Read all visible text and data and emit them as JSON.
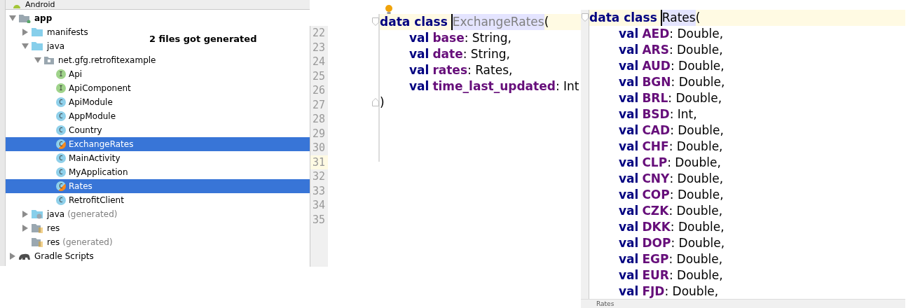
{
  "project_panel": {
    "view_selector": "Android",
    "tree": [
      {
        "label": "app",
        "kind": "module",
        "expanded": true,
        "children": [
          {
            "label": "manifests",
            "kind": "folder",
            "expanded": false
          },
          {
            "label": "java",
            "kind": "folder",
            "expanded": true,
            "children": [
              {
                "label": "net.gfg.retrofitexample",
                "kind": "package",
                "expanded": true,
                "children": [
                  {
                    "label": "Api",
                    "kind": "interface",
                    "badge": "I",
                    "selected": false
                  },
                  {
                    "label": "ApiComponent",
                    "kind": "interface",
                    "badge": "I",
                    "selected": false
                  },
                  {
                    "label": "ApiModule",
                    "kind": "class",
                    "badge": "C",
                    "selected": false
                  },
                  {
                    "label": "AppModule",
                    "kind": "class",
                    "badge": "C",
                    "selected": false
                  },
                  {
                    "label": "Country",
                    "kind": "class",
                    "badge": "C",
                    "selected": false
                  },
                  {
                    "label": "ExchangeRates",
                    "kind": "kotlin_class",
                    "badge": "C",
                    "selected": true
                  },
                  {
                    "label": "MainActivity",
                    "kind": "class",
                    "badge": "C",
                    "selected": false
                  },
                  {
                    "label": "MyApplication",
                    "kind": "class",
                    "badge": "C",
                    "selected": false
                  },
                  {
                    "label": "Rates",
                    "kind": "kotlin_class",
                    "badge": "C",
                    "selected": true
                  },
                  {
                    "label": "RetrofitClient",
                    "kind": "class",
                    "badge": "C",
                    "selected": false
                  }
                ]
              }
            ]
          },
          {
            "label": "java",
            "note": "(generated)",
            "kind": "generated_folder",
            "expanded": false
          },
          {
            "label": "res",
            "kind": "res_folder",
            "expanded": false
          },
          {
            "label": "res",
            "note": "(generated)",
            "kind": "res_folder"
          }
        ]
      },
      {
        "label": "Gradle Scripts",
        "kind": "gradle",
        "expanded": false
      }
    ]
  },
  "annotation": "2 files got generated",
  "line_numbers": [
    {
      "number": "22",
      "current": false
    },
    {
      "number": "23",
      "current": false
    },
    {
      "number": "24",
      "current": false
    },
    {
      "number": "25",
      "current": false
    },
    {
      "number": "26",
      "current": false
    },
    {
      "number": "27",
      "current": false
    },
    {
      "number": "28",
      "current": false
    },
    {
      "number": "29",
      "current": false
    },
    {
      "number": "30",
      "current": false
    },
    {
      "number": "31",
      "current": true
    },
    {
      "number": "32",
      "current": false
    },
    {
      "number": "33",
      "current": false
    },
    {
      "number": "34",
      "current": false
    },
    {
      "number": "35",
      "current": false
    }
  ],
  "editors": [
    {
      "lines": [
        {
          "kind": "declaration",
          "keyword": "data class",
          "name": "ExchangeRates",
          "suffix": "(",
          "unused": true,
          "caret": true,
          "current": true
        },
        {
          "kind": "member",
          "keyword": "val",
          "name": "base",
          "type": ": String,"
        },
        {
          "kind": "member",
          "keyword": "val",
          "name": "date",
          "type": ": String,"
        },
        {
          "kind": "member",
          "keyword": "val",
          "name": "rates",
          "type": ": Rates,"
        },
        {
          "kind": "member",
          "keyword": "val",
          "name": "time_last_updated",
          "type": ": Int"
        },
        {
          "kind": "close",
          "text": ")"
        }
      ]
    },
    {
      "breadcrumb": "Rates",
      "lines": [
        {
          "kind": "declaration",
          "keyword": "data class",
          "name": "Rates",
          "suffix": "(",
          "unused": false,
          "caret": true,
          "current": true
        },
        {
          "kind": "member",
          "keyword": "val",
          "name": "AED",
          "type": ": Double,"
        },
        {
          "kind": "member",
          "keyword": "val",
          "name": "ARS",
          "type": ": Double,"
        },
        {
          "kind": "member",
          "keyword": "val",
          "name": "AUD",
          "type": ": Double,"
        },
        {
          "kind": "member",
          "keyword": "val",
          "name": "BGN",
          "type": ": Double,"
        },
        {
          "kind": "member",
          "keyword": "val",
          "name": "BRL",
          "type": ": Double,"
        },
        {
          "kind": "member",
          "keyword": "val",
          "name": "BSD",
          "type": ": Int,"
        },
        {
          "kind": "member",
          "keyword": "val",
          "name": "CAD",
          "type": ": Double,"
        },
        {
          "kind": "member",
          "keyword": "val",
          "name": "CHF",
          "type": ": Double,"
        },
        {
          "kind": "member",
          "keyword": "val",
          "name": "CLP",
          "type": ": Double,"
        },
        {
          "kind": "member",
          "keyword": "val",
          "name": "CNY",
          "type": ": Double,"
        },
        {
          "kind": "member",
          "keyword": "val",
          "name": "COP",
          "type": ": Double,"
        },
        {
          "kind": "member",
          "keyword": "val",
          "name": "CZK",
          "type": ": Double,"
        },
        {
          "kind": "member",
          "keyword": "val",
          "name": "DKK",
          "type": ": Double,"
        },
        {
          "kind": "member",
          "keyword": "val",
          "name": "DOP",
          "type": ": Double,"
        },
        {
          "kind": "member",
          "keyword": "val",
          "name": "EGP",
          "type": ": Double,"
        },
        {
          "kind": "member",
          "keyword": "val",
          "name": "EUR",
          "type": ": Double,"
        },
        {
          "kind": "member",
          "keyword": "val",
          "name": "FJD",
          "type": ": Double,"
        }
      ]
    }
  ]
}
